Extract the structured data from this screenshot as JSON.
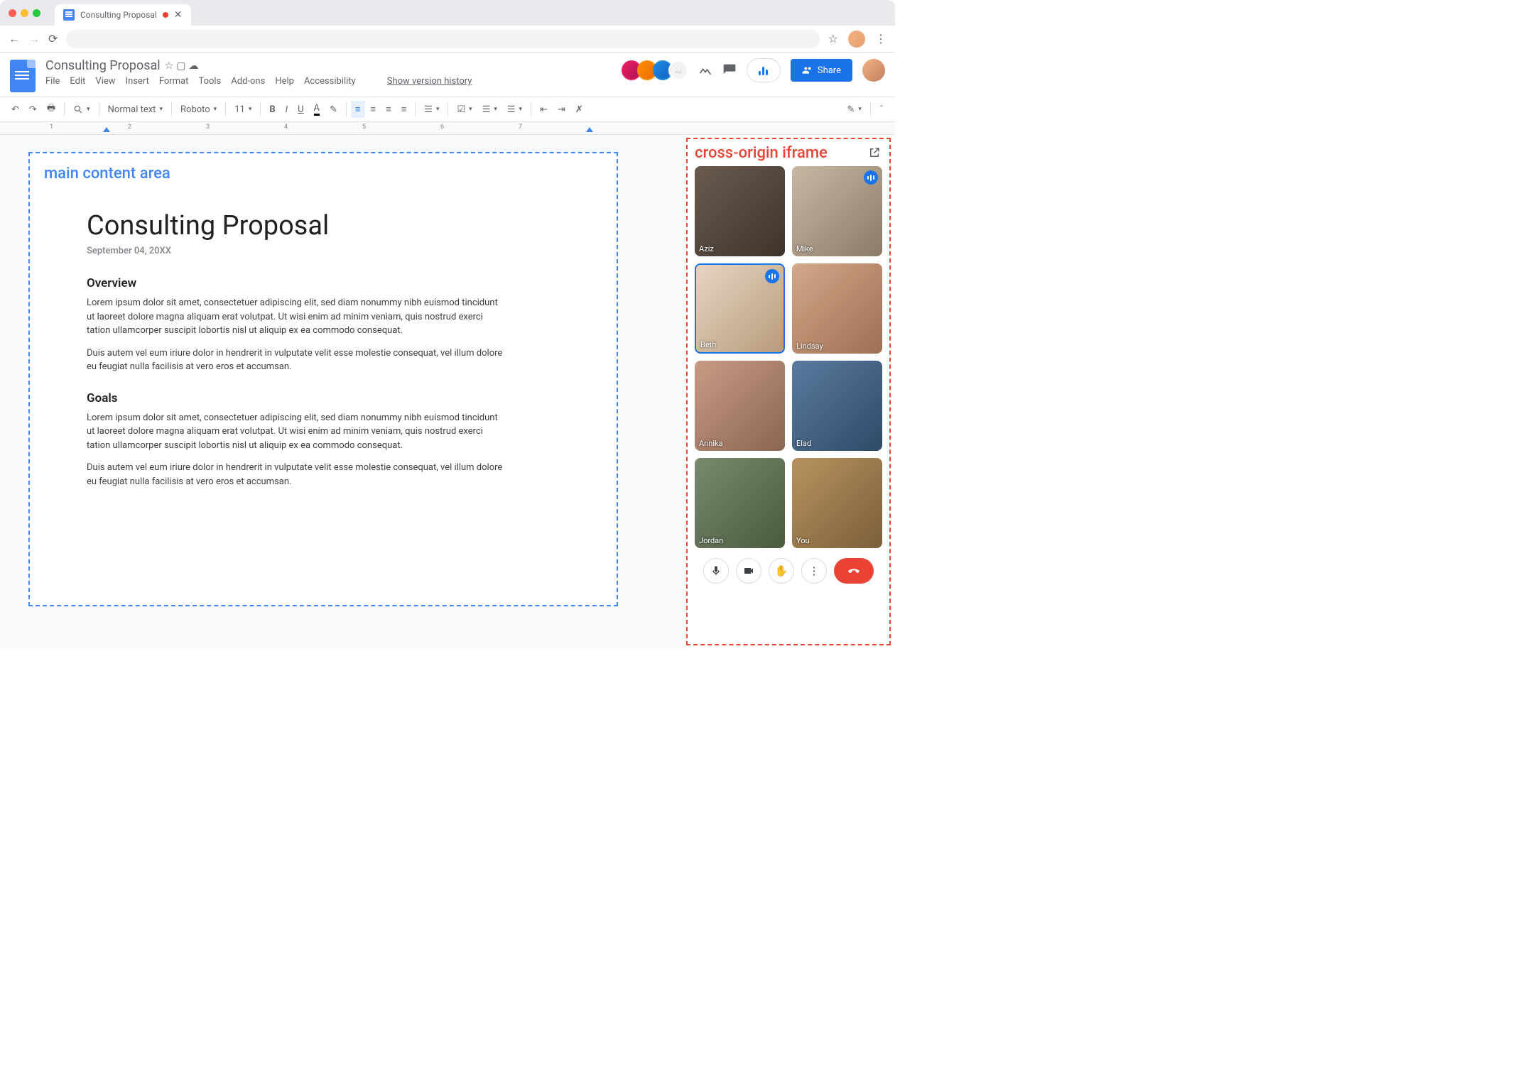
{
  "browser": {
    "tab_title": "Consulting Proposal"
  },
  "docs": {
    "title": "Consulting Proposal",
    "menus": [
      "File",
      "Edit",
      "View",
      "Insert",
      "Format",
      "Tools",
      "Add-ons",
      "Help",
      "Accessibility"
    ],
    "version_history_label": "Show version history",
    "collaborator_overflow": "..."
  },
  "toolbar": {
    "zoom": "…",
    "style": "Normal text",
    "font": "Roboto",
    "size": "11"
  },
  "share_label": "Share",
  "ruler": {
    "ticks": [
      "1",
      "2",
      "3",
      "4",
      "5",
      "6",
      "7"
    ]
  },
  "annotation": {
    "main": "main content area",
    "iframe": "cross-origin iframe"
  },
  "document": {
    "title": "Consulting Proposal",
    "date": "September 04, 20XX",
    "sections": [
      {
        "heading": "Overview",
        "paragraphs": [
          "Lorem ipsum dolor sit amet, consectetuer adipiscing elit, sed diam nonummy nibh euismod tincidunt ut laoreet dolore magna aliquam erat volutpat. Ut wisi enim ad minim veniam, quis nostrud exerci tation ullamcorper suscipit lobortis nisl ut aliquip ex ea commodo consequat.",
          "Duis autem vel eum iriure dolor in hendrerit in vulputate velit esse molestie consequat, vel illum dolore eu feugiat nulla facilisis at vero eros et accumsan."
        ]
      },
      {
        "heading": "Goals",
        "paragraphs": [
          "Lorem ipsum dolor sit amet, consectetuer adipiscing elit, sed diam nonummy nibh euismod tincidunt ut laoreet dolore magna aliquam erat volutpat. Ut wisi enim ad minim veniam, quis nostrud exerci tation ullamcorper suscipit lobortis nisl ut aliquip ex ea commodo consequat.",
          "Duis autem vel eum iriure dolor in hendrerit in vulputate velit esse molestie consequat, vel illum dolore eu feugiat nulla facilisis at vero eros et accumsan."
        ]
      }
    ]
  },
  "call": {
    "participants": [
      {
        "name": "Aziz",
        "speaking": false
      },
      {
        "name": "Mike",
        "speaking": true
      },
      {
        "name": "Beth",
        "speaking": true
      },
      {
        "name": "Lindsay",
        "speaking": false
      },
      {
        "name": "Annika",
        "speaking": false
      },
      {
        "name": "Elad",
        "speaking": false
      },
      {
        "name": "Jordan",
        "speaking": false
      },
      {
        "name": "You",
        "speaking": false
      }
    ]
  }
}
